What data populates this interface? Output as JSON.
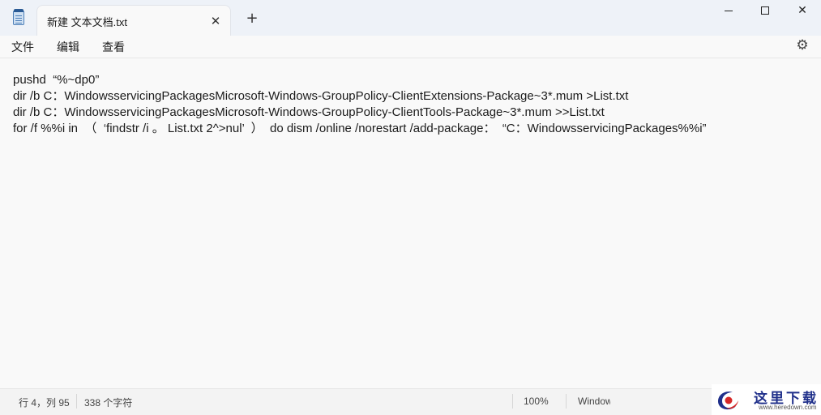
{
  "tab": {
    "title": "新建 文本文档.txt"
  },
  "menu": {
    "file": "文件",
    "edit": "编辑",
    "view": "查看"
  },
  "editor": {
    "lines": [
      "pushd  “%~dp0”",
      "dir /b C：WindowsservicingPackagesMicrosoft-Windows-GroupPolicy-ClientExtensions-Package~3*.mum >List.txt",
      "dir /b C：WindowsservicingPackagesMicrosoft-Windows-GroupPolicy-ClientTools-Package~3*.mum >>List.txt",
      "for /f %%i in  （  ‘findstr /i 。 List.txt 2^>nul’  ）  do dism /online /norestart /add-package：  “C：WindowsservicingPackages%%i”"
    ]
  },
  "status": {
    "position": "行 4，列 95",
    "char_count": "338 个字符",
    "zoom": "100%",
    "line_ending": "Windows (CRLF)"
  },
  "watermark": {
    "text": "这里下载",
    "url": "www.heredown.com"
  },
  "colors": {
    "titlebar": "#eef2f8",
    "editor_bg": "#f9f9f9",
    "watermark_blue": "#1f2f8a",
    "watermark_red": "#d62828"
  }
}
